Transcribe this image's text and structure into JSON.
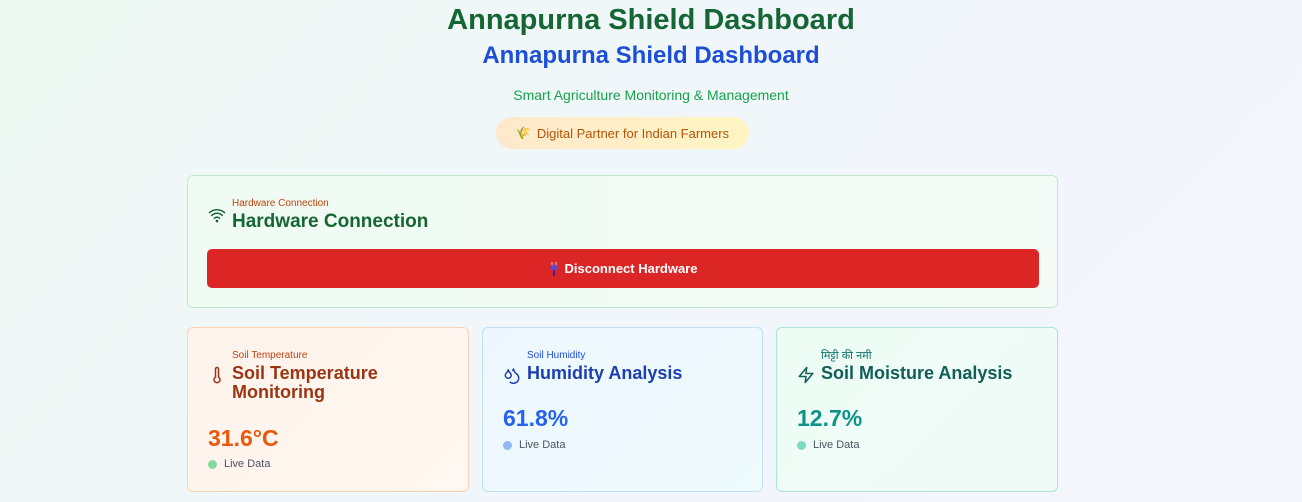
{
  "header": {
    "title": "Annapurna Shield Dashboard",
    "subtitle": "Annapurna Shield Dashboard",
    "tagline": "Smart Agriculture Monitoring & Management",
    "badge_icon": "🌾",
    "badge_text": "Digital Partner for Indian Farmers"
  },
  "hardware": {
    "small_label": "Hardware Connection",
    "title": "Hardware Connection",
    "icon": "wifi-icon",
    "button_icon": "plug-icon",
    "button_label": "Disconnect Hardware"
  },
  "sensors": [
    {
      "small_label": "Soil Temperature",
      "title": "Soil Temperature Monitoring",
      "icon": "thermometer-icon",
      "value": "31.6°C",
      "status": "Live Data"
    },
    {
      "small_label": "Soil Humidity",
      "title": "Humidity Analysis",
      "icon": "droplets-icon",
      "value": "61.8%",
      "status": "Live Data"
    },
    {
      "small_label": "मिट्टी की नमी",
      "title": "Soil Moisture Analysis",
      "icon": "zap-icon",
      "value": "12.7%",
      "status": "Live Data"
    }
  ],
  "colors": {
    "primary_green": "#166534",
    "primary_blue": "#1d4ed8",
    "danger_red": "#dc2626",
    "temperature_orange": "#ea580c",
    "humidity_blue": "#2563eb",
    "moisture_teal": "#0d9488"
  }
}
